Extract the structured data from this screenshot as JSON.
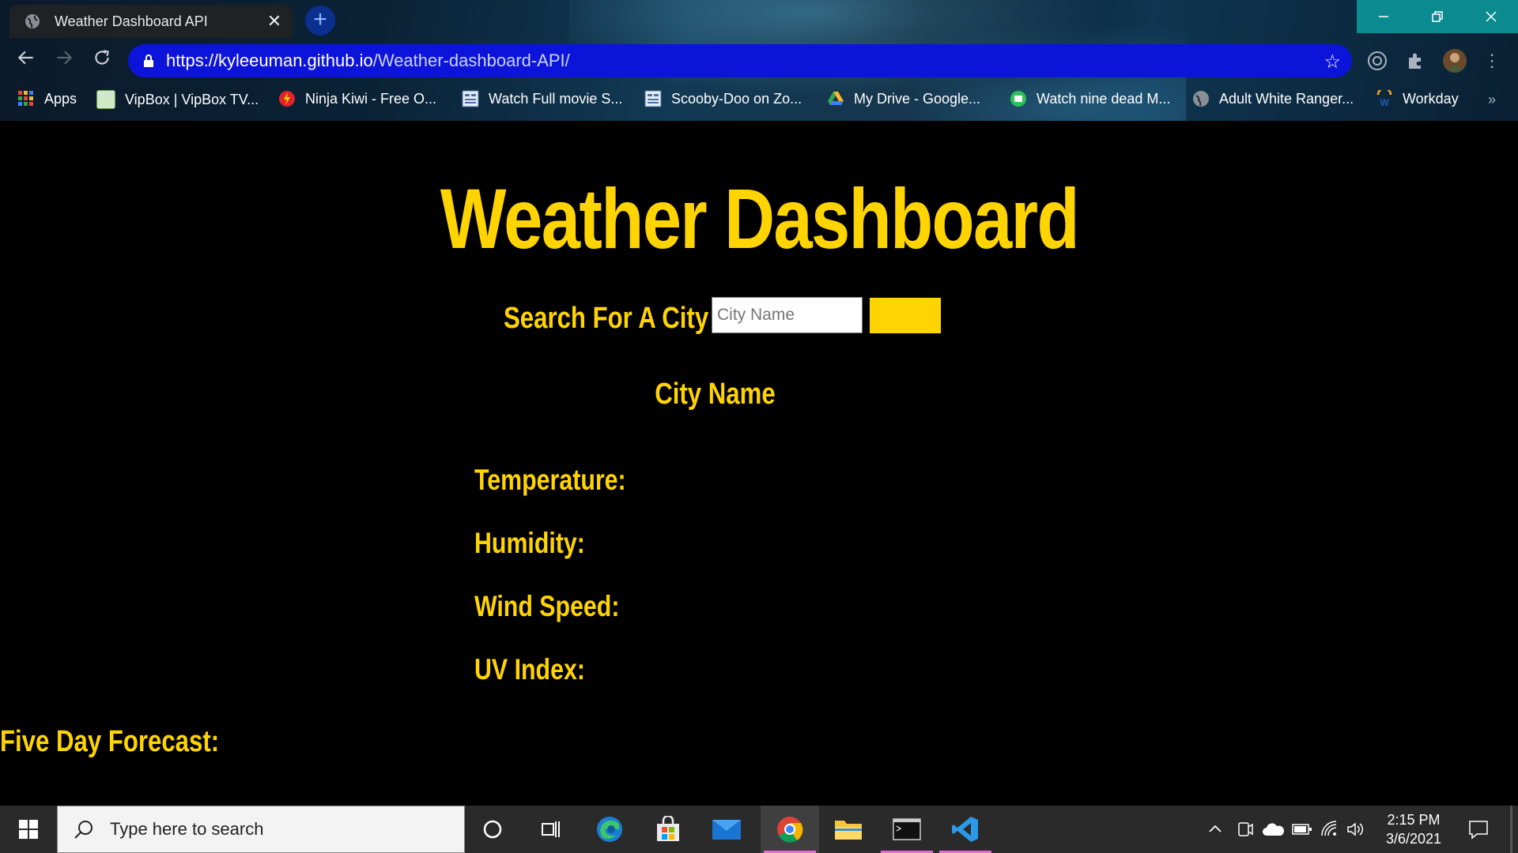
{
  "browser": {
    "tab_title": "Weather Dashboard API",
    "url_host": "https://kyleeuman.github.io",
    "url_path": "/Weather-dashboard-API/",
    "bookmarks": [
      {
        "label": "Apps",
        "icon": "apps-grid-icon"
      },
      {
        "label": "VipBox | VipBox TV...",
        "icon": "vipbox-icon"
      },
      {
        "label": "Ninja Kiwi - Free O...",
        "icon": "ninja-kiwi-icon"
      },
      {
        "label": "Watch Full movie S...",
        "icon": "movie-site-icon"
      },
      {
        "label": "Scooby-Doo on Zo...",
        "icon": "movie-site-icon"
      },
      {
        "label": "My Drive - Google...",
        "icon": "google-drive-icon"
      },
      {
        "label": "Watch nine dead M...",
        "icon": "watch-site-icon"
      },
      {
        "label": "Adult White Ranger...",
        "icon": "globe-icon"
      },
      {
        "label": "Workday",
        "icon": "workday-icon"
      }
    ],
    "more_bookmarks": "»"
  },
  "page": {
    "title": "Weather Dashboard",
    "search_label": "Search For A City",
    "search_placeholder": "City Name",
    "search_button_label": "",
    "city_name": "City Name",
    "stats": {
      "temperature": "Temperature:",
      "humidity": "Humidity:",
      "wind_speed": "Wind Speed:",
      "uv_index": "UV Index:"
    },
    "forecast_heading": "Five Day Forecast:"
  },
  "taskbar": {
    "search_placeholder": "Type here to search",
    "time": "2:15 PM",
    "date": "3/6/2021"
  },
  "colors": {
    "accent": "#ffd400",
    "page_background": "#000000",
    "omnibox": "#0d14d9"
  }
}
